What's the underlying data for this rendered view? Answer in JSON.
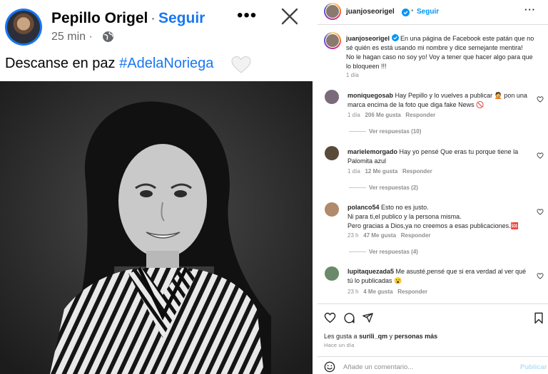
{
  "facebook_post": {
    "author": "Pepillo Origel",
    "separator": "·",
    "follow_label": "Seguir",
    "time": "25 min ·",
    "more_label": "•••",
    "caption_text": "Descanse en paz",
    "caption_hashtag": "#AdelaNoriega",
    "icons": {
      "globe": "globe-icon",
      "close": "close-icon",
      "heart": "white-heart-icon"
    }
  },
  "instagram": {
    "header": {
      "username": "juanjoseorigel",
      "separator": "•",
      "follow_label": "Seguir"
    },
    "caption": {
      "username": "juanjoseorigel",
      "lines": [
        "En una página de Facebook este patán que no",
        "sé quién es está usando mi nombre y dice semejante mentira!",
        "No le hagan caso no soy yo! Voy a tener que hacer algo para que",
        "lo bloqueen !!!"
      ],
      "time": "1 día"
    },
    "comments": [
      {
        "username": "moniquegosab",
        "lines": [
          "Hay Pepillo y lo vuelves a publicar 🤦 pon una",
          "marca encima de la foto que diga fake News 🚫"
        ],
        "time": "1 día",
        "likes": "206 Me gusta",
        "reply": "Responder",
        "view_replies": "Ver respuestas (10)"
      },
      {
        "username": "marielemorgado",
        "lines": [
          "Hay yo pensé Que eras tu porque tiene la",
          "Palomita azul"
        ],
        "time": "1 día",
        "likes": "12 Me gusta",
        "reply": "Responder",
        "view_replies": "Ver respuestas (2)"
      },
      {
        "username": "polanco54",
        "lines": [
          "Esto no es justo.",
          "Ni para ti,el publico y la persona misma.",
          "Pero gracias a Dios,ya no creemos a esas publicaciones.🆘"
        ],
        "time": "23 h",
        "likes": "47 Me gusta",
        "reply": "Responder",
        "view_replies": "Ver respuestas (4)"
      },
      {
        "username": "lupitaquezada5",
        "lines": [
          "Me asusté,pensé que si era verdad al ver qué",
          "tú lo publicadas 😮"
        ],
        "time": "23 h",
        "likes": "4 Me gusta",
        "reply": "Responder"
      }
    ],
    "likes_text_prefix": "Les gusta a",
    "likes_user": "surili_qm",
    "likes_text_suffix": "y",
    "likes_others": "personas más",
    "post_time": "Hace un día",
    "add_comment_placeholder": "Añade un comentario...",
    "publish_label": "Publicar",
    "colors": {
      "accent": "#0095f6",
      "fb_blue": "#1877f2",
      "verified": "#0095f6"
    }
  }
}
